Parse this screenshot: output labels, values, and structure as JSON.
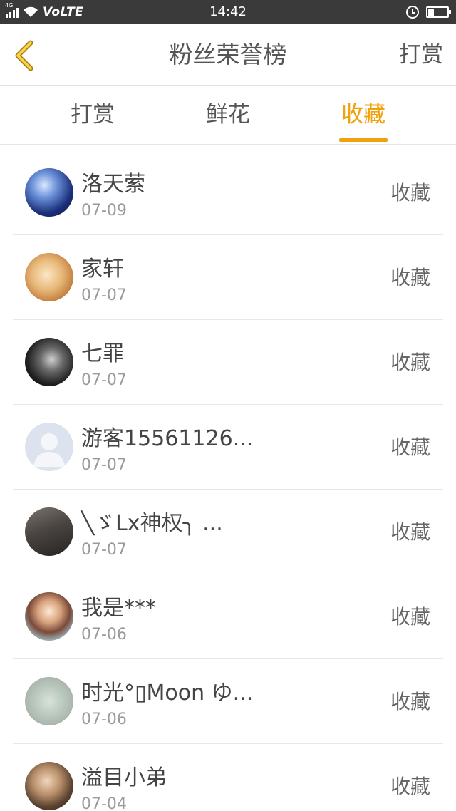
{
  "status_bar": {
    "network": "4G",
    "carrier_label": "VoLTE",
    "time": "14:42",
    "icons": [
      "signal-icon",
      "wifi-icon",
      "alarm-icon",
      "battery-icon"
    ]
  },
  "header": {
    "title": "粉丝荣誉榜",
    "action_label": "打赏",
    "back_icon": "chevron-left-icon",
    "accent_color": "#f0a20c"
  },
  "tabs": [
    {
      "label": "打赏",
      "active": false
    },
    {
      "label": "鲜花",
      "active": false
    },
    {
      "label": "收藏",
      "active": true
    }
  ],
  "fans": [
    {
      "name": "洛天萦",
      "date": "07-09",
      "action": "收藏"
    },
    {
      "name": "家轩",
      "date": "07-07",
      "action": "收藏"
    },
    {
      "name": "七罪",
      "date": "07-07",
      "action": "收藏"
    },
    {
      "name": "游客15561126...",
      "date": "07-07",
      "action": "收藏"
    },
    {
      "name": "╲ゞLx神权╮ ...",
      "date": "07-07",
      "action": "收藏"
    },
    {
      "name": "我是***",
      "date": "07-06",
      "action": "收藏"
    },
    {
      "name": "时光°▯Moon ゆ...",
      "date": "07-06",
      "action": "收藏"
    },
    {
      "name": "溢目小弟",
      "date": "07-04",
      "action": "收藏"
    }
  ]
}
